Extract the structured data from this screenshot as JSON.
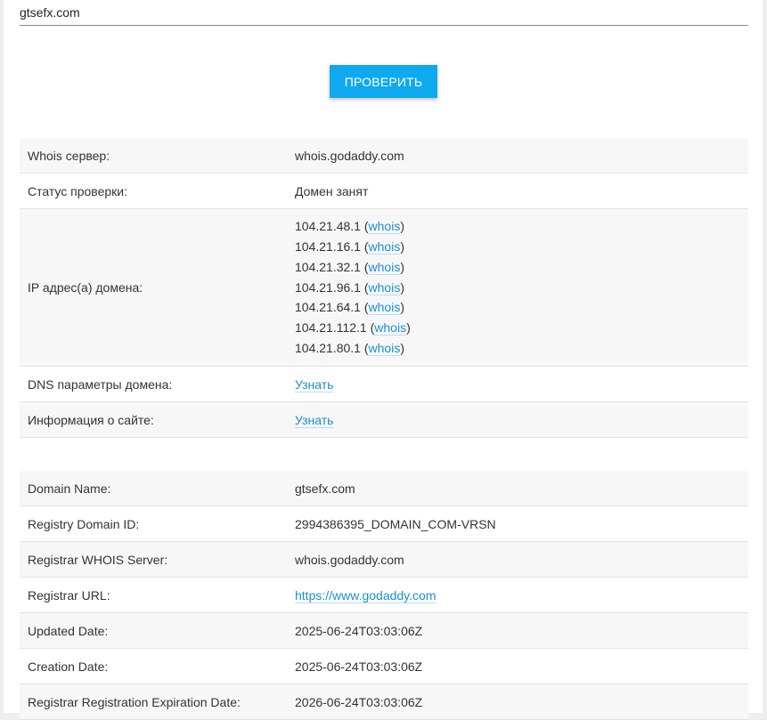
{
  "search": {
    "value": "gtsefx.com"
  },
  "check_button": {
    "label": "ПРОВЕРИТЬ"
  },
  "summary": {
    "whois_server": {
      "label": "Whois сервер:",
      "value": "whois.godaddy.com"
    },
    "status": {
      "label": "Статус проверки:",
      "value": "Домен занят"
    },
    "ips": {
      "label": "IP адрес(а) домена:",
      "link_text": "whois",
      "items": [
        "104.21.48.1",
        "104.21.16.1",
        "104.21.32.1",
        "104.21.96.1",
        "104.21.64.1",
        "104.21.112.1",
        "104.21.80.1"
      ]
    },
    "dns": {
      "label": "DNS параметры домена:",
      "link": "Узнать"
    },
    "site_info": {
      "label": "Информация о сайте:",
      "link": "Узнать"
    }
  },
  "whois": {
    "rows": [
      {
        "label": "Domain Name:",
        "value": "gtsefx.com"
      },
      {
        "label": "Registry Domain ID:",
        "value": "2994386395_DOMAIN_COM-VRSN"
      },
      {
        "label": "Registrar WHOIS Server:",
        "value": "whois.godaddy.com"
      },
      {
        "label": "Registrar URL:",
        "value": "https://www.godaddy.com"
      },
      {
        "label": "Updated Date:",
        "value": "2025-06-24T03:03:06Z"
      },
      {
        "label": "Creation Date:",
        "value": "2025-06-24T03:03:06Z"
      },
      {
        "label": "Registrar Registration Expiration Date:",
        "value": "2026-06-24T03:03:06Z"
      }
    ]
  },
  "colors": {
    "accent": "#0fa9f0",
    "link": "#1a8fd6",
    "row_alt": "#f7f7f7"
  }
}
